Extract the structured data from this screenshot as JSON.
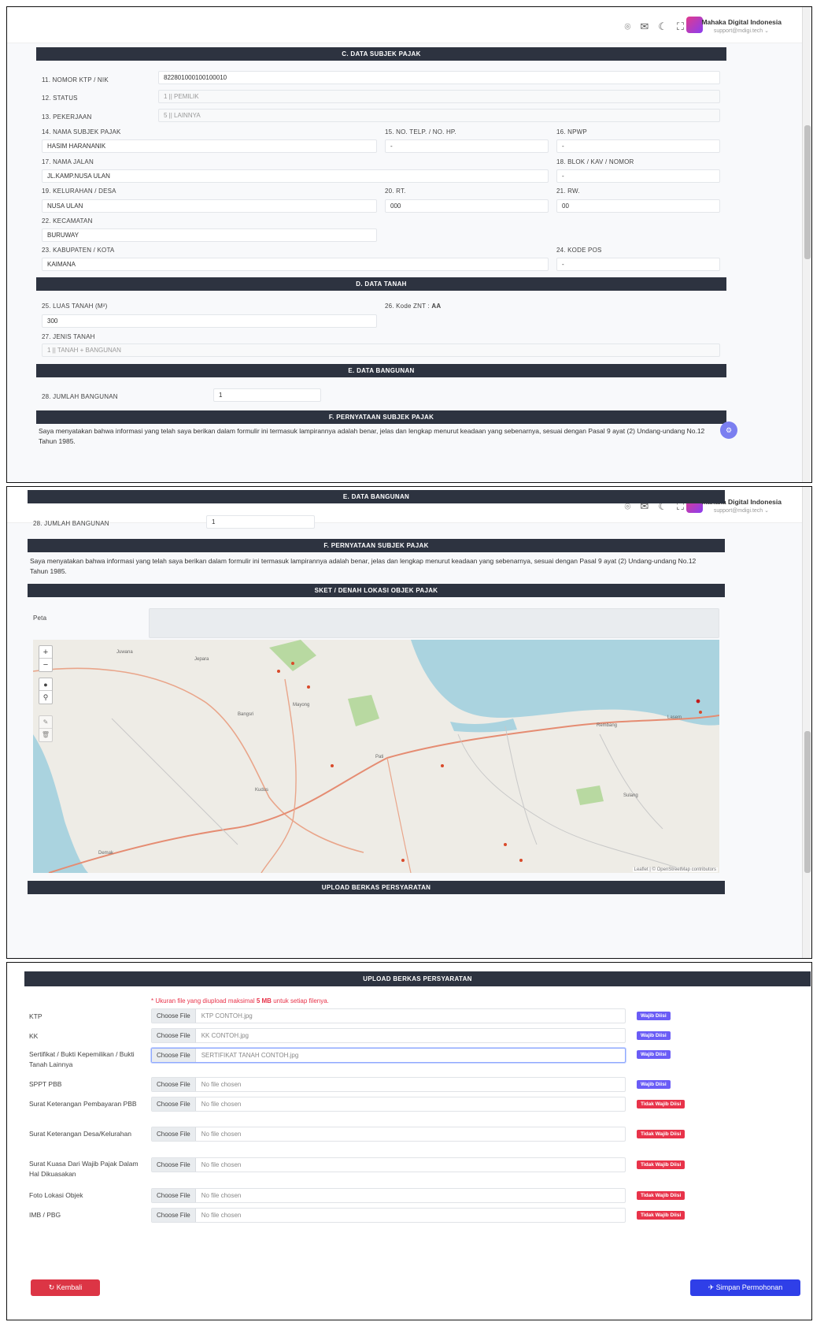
{
  "topbar": {
    "icons": [
      "map-pin-icon",
      "mail-icon",
      "moon-icon",
      "fullscreen-icon"
    ],
    "user_name": "Mahaka Digital Indonesia",
    "user_email": "support@mdigi.tech ⌄"
  },
  "panel1": {
    "sec_c": "C. DATA SUBJEK PAJAK",
    "f11_l": "11. NOMOR KTP / NIK",
    "f11_v": "822801000100100010",
    "f12_l": "12. STATUS",
    "f12_v": "1 || PEMILIK",
    "f13_l": "13. PEKERJAAN",
    "f13_v": "5 || LAINNYA",
    "f14_l": "14. NAMA SUBJEK PAJAK",
    "f14_v": "HASIM HARANANIK",
    "f15_l": "15. NO. TELP. / NO. HP.",
    "f15_v": "-",
    "f16_l": "16. NPWP",
    "f16_v": "-",
    "f17_l": "17. NAMA JALAN",
    "f17_v": "JL.KAMP.NUSA ULAN",
    "f18_l": "18. BLOK / KAV / NOMOR",
    "f18_v": "-",
    "f19_l": "19. KELURAHAN / DESA",
    "f19_v": "NUSA ULAN",
    "f20_l": "20. RT.",
    "f20_v": "000",
    "f21_l": "21. RW.",
    "f21_v": "00",
    "f22_l": "22. KECAMATAN",
    "f22_v": "BURUWAY",
    "f23_l": "23. KABUPATEN / KOTA",
    "f23_v": "KAIMANA",
    "f24_l": "24. KODE POS",
    "f24_v": "-",
    "sec_d": "D. DATA TANAH",
    "f25_l": "25. LUAS TANAH (M²)",
    "f25_v": "300",
    "f26_l": "26. Kode ZNT :",
    "f26_v": "AA",
    "f27_l": "27. JENIS TANAH",
    "f27_v": "1 || TANAH + BANGUNAN",
    "sec_e": "E. DATA BANGUNAN",
    "f28_l": "28. JUMLAH BANGUNAN",
    "f28_v": "1",
    "sec_f": "F. PERNYATAAN SUBJEK PAJAK",
    "statement": "Saya menyatakan bahwa informasi yang telah saya berikan dalam formulir ini termasuk lampirannya adalah benar, jelas dan lengkap menurut keadaan yang sebenarnya, sesuai dengan Pasal 9 ayat (2) Undang-undang No.12 Tahun 1985."
  },
  "panel2": {
    "sec_e": "E. DATA BANGUNAN",
    "f28_l": "28. JUMLAH BANGUNAN",
    "f28_v": "1",
    "sec_f": "F. PERNYATAAN SUBJEK PAJAK",
    "statement": "Saya menyatakan bahwa informasi yang telah saya berikan dalam formulir ini termasuk lampirannya adalah benar, jelas dan lengkap menurut keadaan yang sebenarnya, sesuai dengan Pasal 9 ayat (2) Undang-undang No.12 Tahun 1985.",
    "sec_sket": "SKET / DENAH LOKASI OBJEK PAJAK",
    "peta_l": "Peta",
    "map_places": [
      "Jepara",
      "Kudus",
      "Pati",
      "Demak",
      "Juwana",
      "Rembang",
      "Lasem",
      "Sulang",
      "Mayong",
      "Bangsri"
    ],
    "map_zoom_in": "+",
    "map_zoom_out": "−",
    "map_attrib": "Leaflet | © OpenStreetMap contributors",
    "sec_upload": "UPLOAD BERKAS PERSYARATAN"
  },
  "panel3": {
    "sec_upload": "UPLOAD BERKAS PERSYARATAN",
    "note_pre": "* Ukuran file yang diupload maksimal ",
    "note_bold": "5 MB",
    "note_post": " untuk setiap filenya.",
    "choose": "Choose File",
    "files": [
      {
        "label": "KTP",
        "file": "KTP CONTOH.jpg",
        "badge": "Wajib Diisi",
        "req": true
      },
      {
        "label": "KK",
        "file": "KK CONTOH.jpg",
        "badge": "Wajib Diisi",
        "req": true
      },
      {
        "label": "Sertifikat / Bukti Kepemilikan / Bukti Tanah Lainnya",
        "file": "SERTIFIKAT TANAH CONTOH.jpg",
        "badge": "Wajib Diisi",
        "req": true
      },
      {
        "label": "SPPT PBB",
        "file": "No file chosen",
        "badge": "Wajib Diisi",
        "req": true
      },
      {
        "label": "Surat Keterangan Pembayaran PBB",
        "file": "No file chosen",
        "badge": "Tidak Wajib Diisi",
        "req": false
      },
      {
        "label": "Surat Keterangan Desa/Kelurahan",
        "file": "No file chosen",
        "badge": "Tidak Wajib Diisi",
        "req": false
      },
      {
        "label": "Surat Kuasa Dari Wajib Pajak Dalam Hal Dikuasakan",
        "file": "No file chosen",
        "badge": "Tidak Wajib Diisi",
        "req": false
      },
      {
        "label": "Foto Lokasi Objek",
        "file": "No file chosen",
        "badge": "Tidak Wajib Diisi",
        "req": false
      },
      {
        "label": "IMB / PBG",
        "file": "No file chosen",
        "badge": "Tidak Wajib Diisi",
        "req": false
      }
    ],
    "back_label": "↻ Kembali",
    "save_label": "✈ Simpan Permohonan"
  },
  "colors": {
    "section": "#2d3340",
    "required": "#6a5cf6",
    "optional": "#e8334a",
    "back": "#dc3545",
    "save": "#2f3fe8",
    "sea": "#aad3df"
  }
}
